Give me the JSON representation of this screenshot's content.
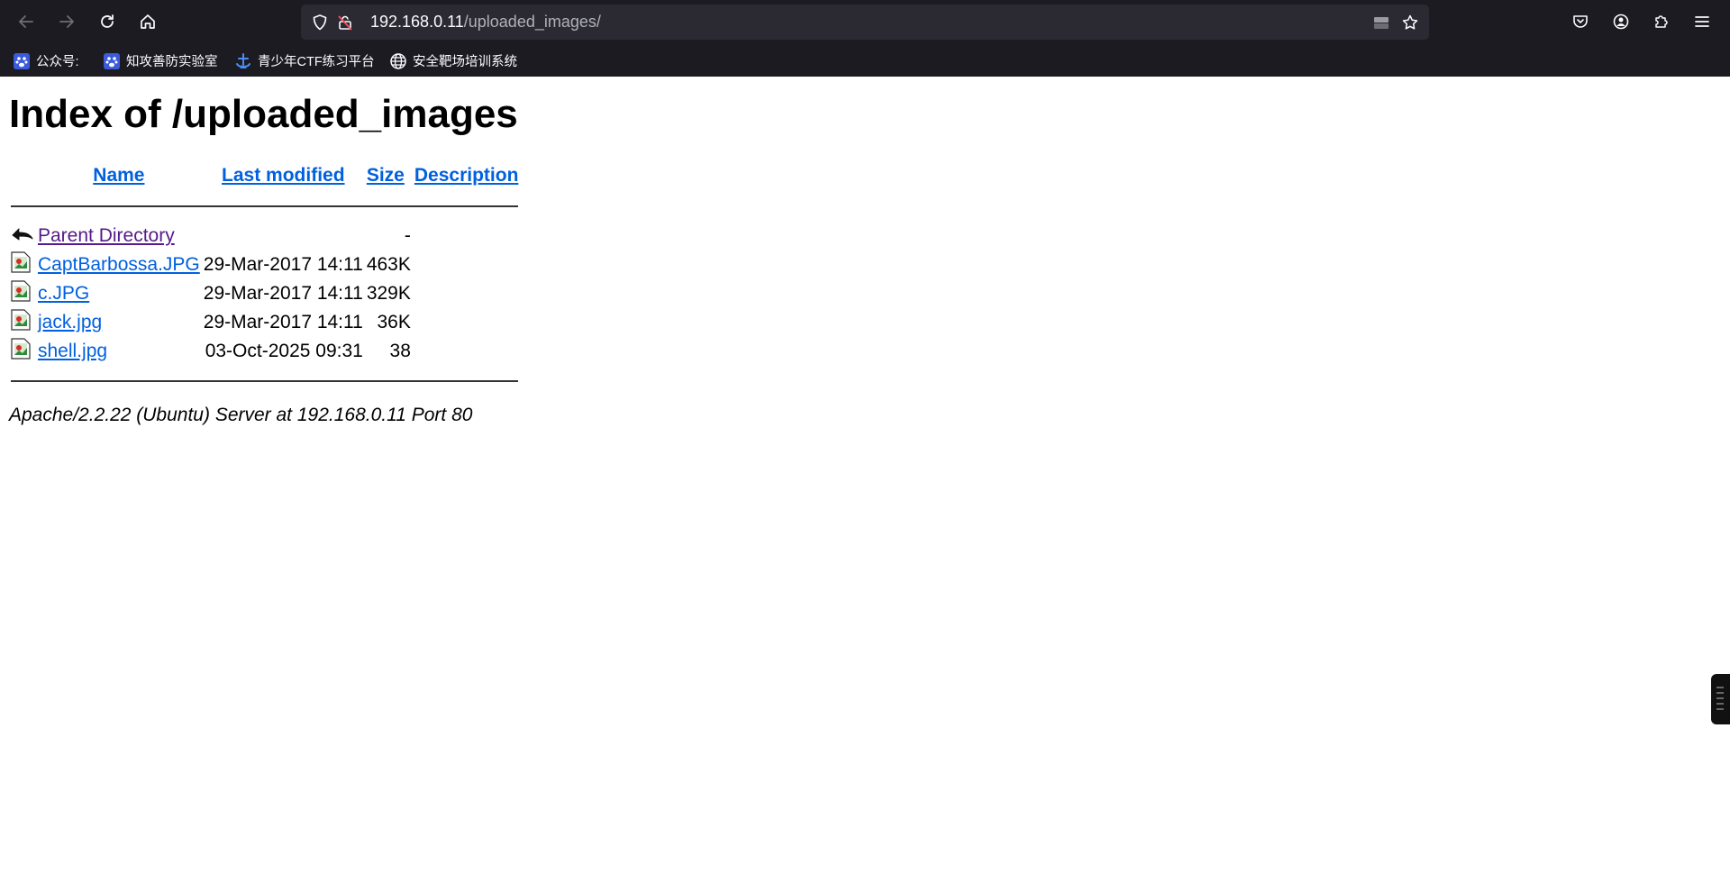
{
  "browser": {
    "url_host": "192.168.0.11",
    "url_path": "/uploaded_images/",
    "bookmarks": [
      {
        "label": "公众号:",
        "icon": "paw-icon"
      },
      {
        "label": "知攻善防实验室",
        "icon": "paw-icon"
      },
      {
        "label": "青少年CTF练习平台",
        "icon": "ship-icon"
      },
      {
        "label": "安全靶场培训系统",
        "icon": "globe-icon"
      }
    ]
  },
  "page": {
    "title": "Index of /uploaded_images",
    "columns": [
      "Name",
      "Last modified",
      "Size",
      "Description"
    ],
    "rows": [
      {
        "name": "Parent Directory",
        "modified": "",
        "size": "-",
        "description": "",
        "icon": "back-arrow-icon"
      },
      {
        "name": "CaptBarbossa.JPG",
        "modified": "29-Mar-2017 14:11",
        "size": "463K",
        "description": "",
        "icon": "image-file-icon"
      },
      {
        "name": "c.JPG",
        "modified": "29-Mar-2017 14:11",
        "size": "329K",
        "description": "",
        "icon": "image-file-icon"
      },
      {
        "name": "jack.jpg",
        "modified": "29-Mar-2017 14:11",
        "size": "36K",
        "description": "",
        "icon": "image-file-icon"
      },
      {
        "name": "shell.jpg",
        "modified": "03-Oct-2025 09:31",
        "size": "38",
        "description": "",
        "icon": "image-file-icon"
      }
    ],
    "footer": "Apache/2.2.22 (Ubuntu) Server at 192.168.0.11 Port 80"
  },
  "colors": {
    "chrome_bg": "#1c1b22",
    "urlbar_bg": "#2b2a33",
    "link": "#0060df",
    "visited_link": "#551a8b"
  }
}
